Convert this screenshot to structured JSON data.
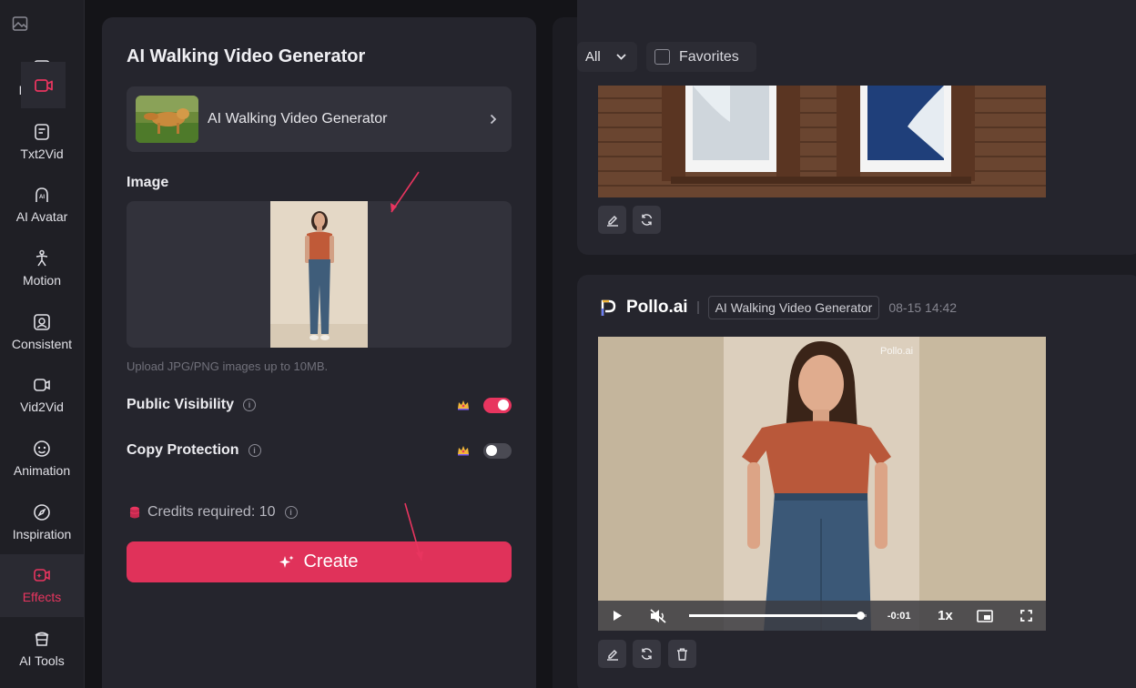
{
  "rail": {
    "items": [
      {
        "label": "Img2Vid",
        "icon": "image-video-icon"
      },
      {
        "label": "Txt2Vid",
        "icon": "text-video-icon"
      },
      {
        "label": "AI Avatar",
        "icon": "ai-avatar-icon"
      },
      {
        "label": "Motion",
        "icon": "motion-icon"
      },
      {
        "label": "Consistent",
        "icon": "consistent-icon"
      },
      {
        "label": "Vid2Vid",
        "icon": "vid2vid-icon"
      },
      {
        "label": "Animation",
        "icon": "animation-icon"
      },
      {
        "label": "Inspiration",
        "icon": "compass-icon"
      },
      {
        "label": "Effects",
        "icon": "effects-icon",
        "active": true
      },
      {
        "label": "AI Tools",
        "icon": "ai-tools-icon"
      }
    ]
  },
  "panel": {
    "title": "AI Walking Video Generator",
    "tool_name": "AI Walking Video Generator",
    "image_label": "Image",
    "upload_hint": "Upload JPG/PNG images up to 10MB.",
    "public_visibility": {
      "label": "Public Visibility",
      "enabled": true
    },
    "copy_protection": {
      "label": "Copy Protection",
      "enabled": false
    },
    "credits": "Credits required: 10",
    "create_label": "Create"
  },
  "filters": {
    "selected": "All",
    "favorites_label": "Favorites"
  },
  "result": {
    "brand": "Pollo.ai",
    "tag": "AI Walking Video Generator",
    "timestamp": "08-15 14:42",
    "watermark": "Pollo.ai",
    "time_remaining": "-0:01",
    "speed": "1x",
    "progress": 0.97
  },
  "colors": {
    "accent": "#e0325a",
    "panel": "#25252d",
    "background": "#141418"
  }
}
